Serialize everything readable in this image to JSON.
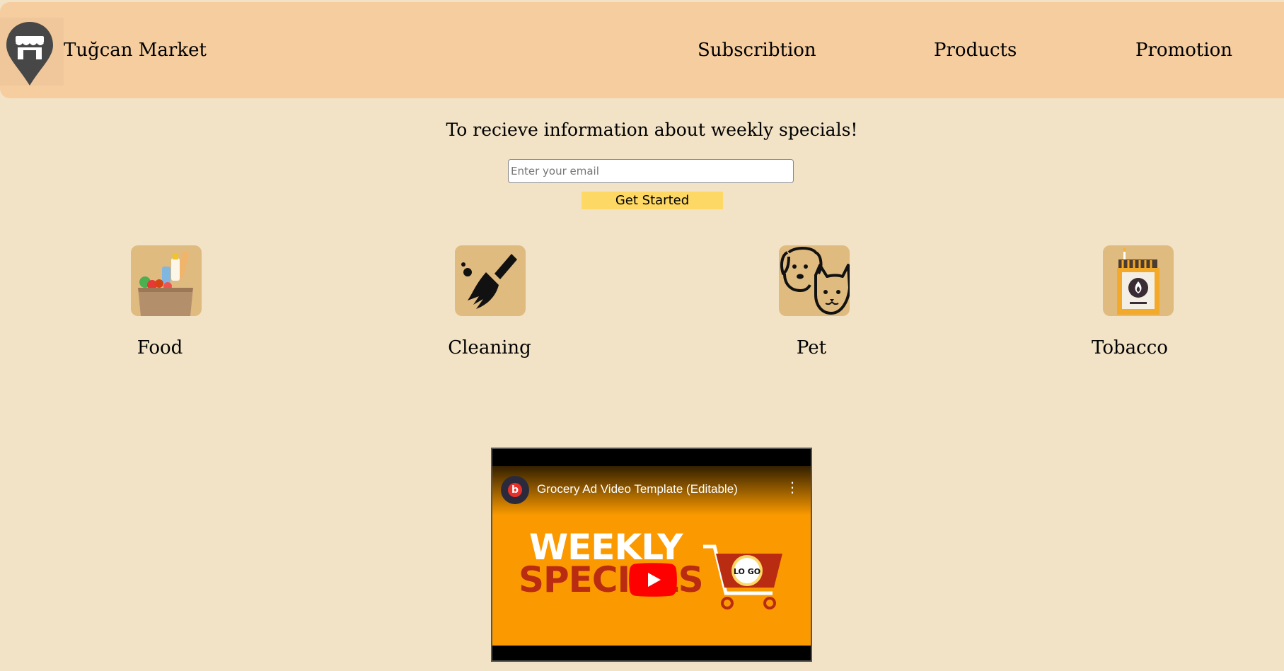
{
  "header": {
    "brand": "Tuğcan Market",
    "logo_icon": "store-pin-icon",
    "nav": [
      {
        "label": "Subscribtion"
      },
      {
        "label": "Products"
      },
      {
        "label": "Promotion"
      }
    ]
  },
  "subscribe": {
    "title": "To recieve information about weekly specials!",
    "email_placeholder": "Enter your email",
    "email_value": "",
    "button_label": "Get Started"
  },
  "categories": [
    {
      "label": "Food",
      "icon": "grocery-bag-icon"
    },
    {
      "label": "Cleaning",
      "icon": "broom-icon"
    },
    {
      "label": "Pet",
      "icon": "dog-cat-icon"
    },
    {
      "label": "Tobacco",
      "icon": "cigarette-pack-icon"
    }
  ],
  "video": {
    "title": "Grocery Ad Video Template (Editable)",
    "channel_initial": "b",
    "thumbnail_line1": "WEEKLY",
    "thumbnail_line2": "SPECIALS",
    "thumbnail_logo": "LO GO",
    "menu_glyph": "⋮"
  },
  "colors": {
    "background": "#f2e3c6",
    "header": "#f6cd9e",
    "button": "#fdd865",
    "icon_tile": "#dfbb80",
    "video_orange": "#fb9a00"
  }
}
